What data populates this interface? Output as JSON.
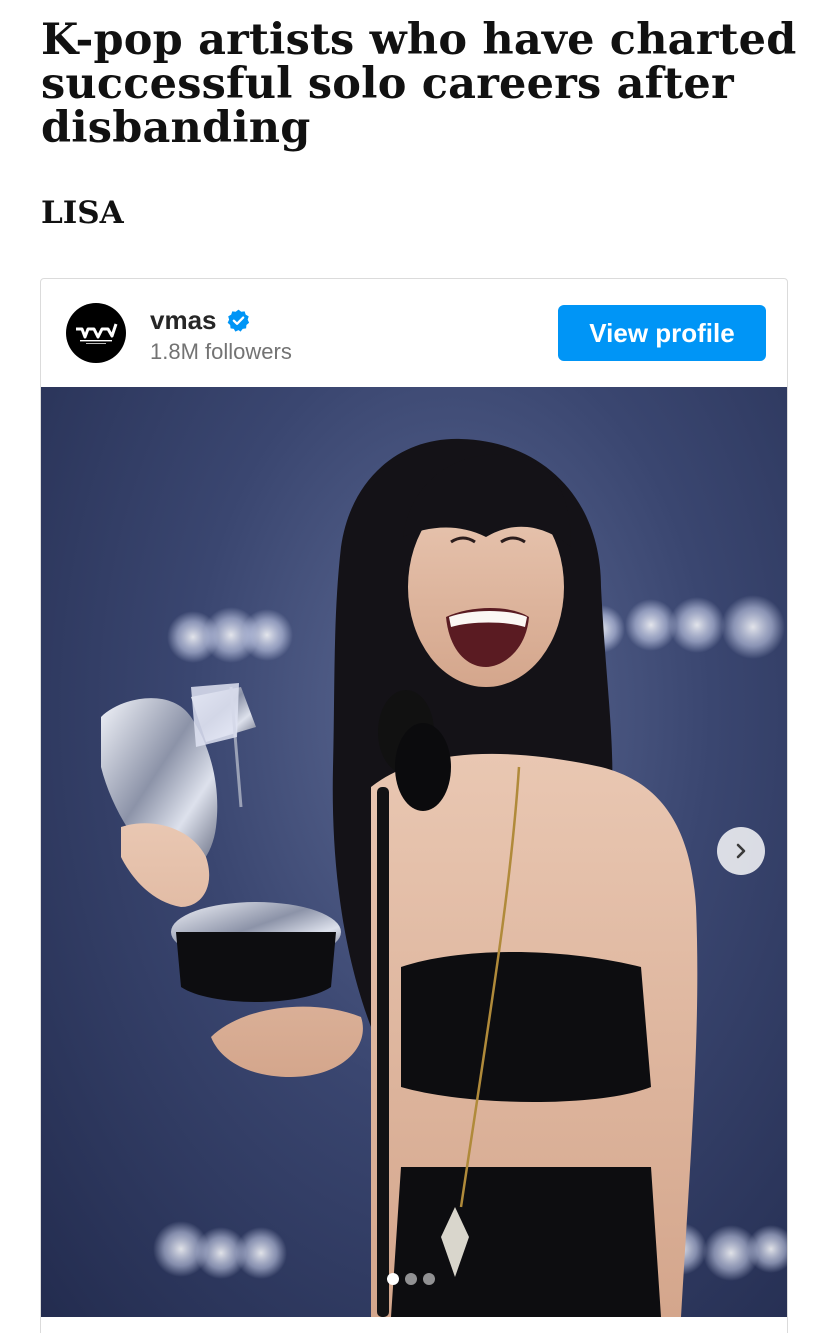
{
  "article": {
    "headline": "K-pop artists who have charted successful solo careers after disbanding",
    "section_name": "LISA"
  },
  "embed": {
    "account": {
      "username": "vmas",
      "verified": true,
      "followers": "1.8M followers",
      "avatar_text": "VMA"
    },
    "view_profile_label": "View profile",
    "carousel": {
      "current_index": 1,
      "total": 3
    },
    "colors": {
      "button": "#0095f6",
      "verified_badge": "#0095f6",
      "followers_text": "#737373"
    }
  }
}
